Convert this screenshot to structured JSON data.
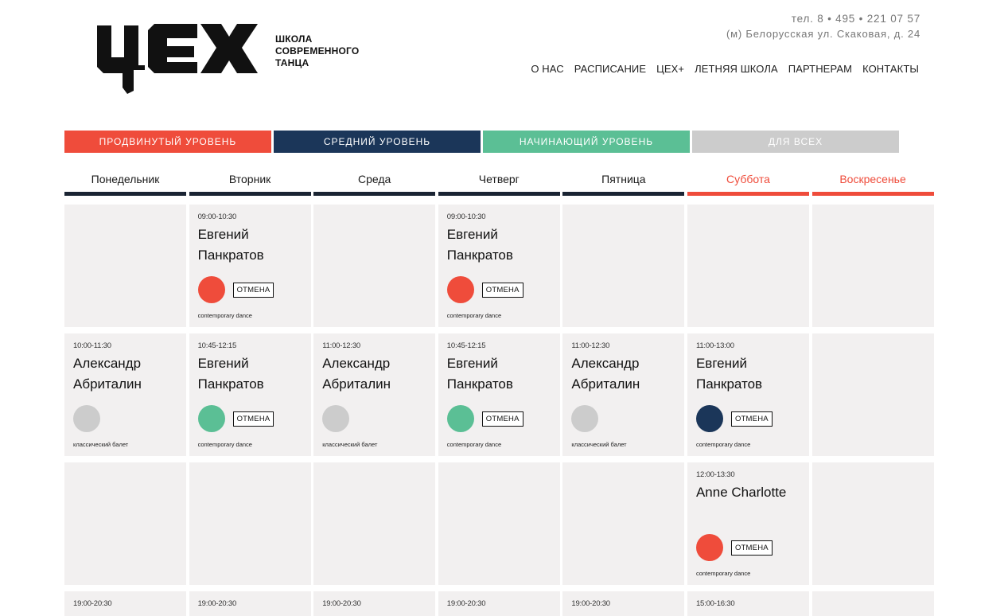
{
  "header": {
    "school_lines": [
      "ШКОЛА",
      "СОВРЕМЕННОГО",
      "ТАНЦА"
    ],
    "phone": "тел. 8 • 495 • 221 07 57",
    "address": "(м) Белорусская ул. Скаковая, д. 24",
    "nav": [
      "О НАС",
      "РАСПИСАНИЕ",
      "ЦЕХ+",
      "ЛЕТНЯЯ ШКОЛА",
      "ПАРТНЕРАМ",
      "КОНТАКТЫ"
    ]
  },
  "levels": [
    {
      "label": "ПРОДВИНУТЫЙ УРОВЕНЬ",
      "color": "#ef4c3b"
    },
    {
      "label": "СРЕДНИЙ УРОВЕНЬ",
      "color": "#1b3659"
    },
    {
      "label": "НАЧИНАЮЩИЙ УРОВЕНЬ",
      "color": "#5bbf95"
    },
    {
      "label": "ДЛЯ ВСЕХ",
      "color": "#cccccc"
    }
  ],
  "days": [
    "Понедельник",
    "Вторник",
    "Среда",
    "Четверг",
    "Пятница",
    "Суббота",
    "Воскресенье"
  ],
  "cancel_label": "ОТМЕНА",
  "level_colors": {
    "red": "#ef4c3b",
    "navy": "#1b3659",
    "green": "#5bbf95",
    "gray": "#cccccc"
  },
  "rows": [
    [
      null,
      {
        "time": "09:00-10:30",
        "teacher": [
          "Евгений",
          "Панкратов"
        ],
        "level": "red",
        "cancel": true,
        "style": "contemporary dance"
      },
      null,
      {
        "time": "09:00-10:30",
        "teacher": [
          "Евгений",
          "Панкратов"
        ],
        "level": "red",
        "cancel": true,
        "style": "contemporary dance"
      },
      null,
      null,
      null
    ],
    [
      {
        "time": "10:00-11:30",
        "teacher": [
          "Александр",
          "Абриталин"
        ],
        "level": "gray",
        "cancel": false,
        "style": "классический балет"
      },
      {
        "time": "10:45-12:15",
        "teacher": [
          "Евгений",
          "Панкратов"
        ],
        "level": "green",
        "cancel": true,
        "style": "contemporary dance"
      },
      {
        "time": "11:00-12:30",
        "teacher": [
          "Александр",
          "Абриталин"
        ],
        "level": "gray",
        "cancel": false,
        "style": "классический балет"
      },
      {
        "time": "10:45-12:15",
        "teacher": [
          "Евгений",
          "Панкратов"
        ],
        "level": "green",
        "cancel": true,
        "style": "contemporary dance"
      },
      {
        "time": "11:00-12:30",
        "teacher": [
          "Александр",
          "Абриталин"
        ],
        "level": "gray",
        "cancel": false,
        "style": "классический балет"
      },
      {
        "time": "11:00-13:00",
        "teacher": [
          "Евгений",
          "Панкратов"
        ],
        "level": "navy",
        "cancel": true,
        "style": "contemporary dance"
      },
      null
    ],
    [
      null,
      null,
      null,
      null,
      null,
      {
        "time": "12:00-13:30",
        "teacher": [
          "Anne Charlotte"
        ],
        "level": "red",
        "cancel": true,
        "style": "contemporary dance"
      },
      null
    ],
    [
      {
        "time": "19:00-20:30"
      },
      {
        "time": "19:00-20:30"
      },
      {
        "time": "19:00-20:30"
      },
      {
        "time": "19:00-20:30"
      },
      {
        "time": "19:00-20:30"
      },
      {
        "time": "15:00-16:30"
      },
      null
    ]
  ]
}
